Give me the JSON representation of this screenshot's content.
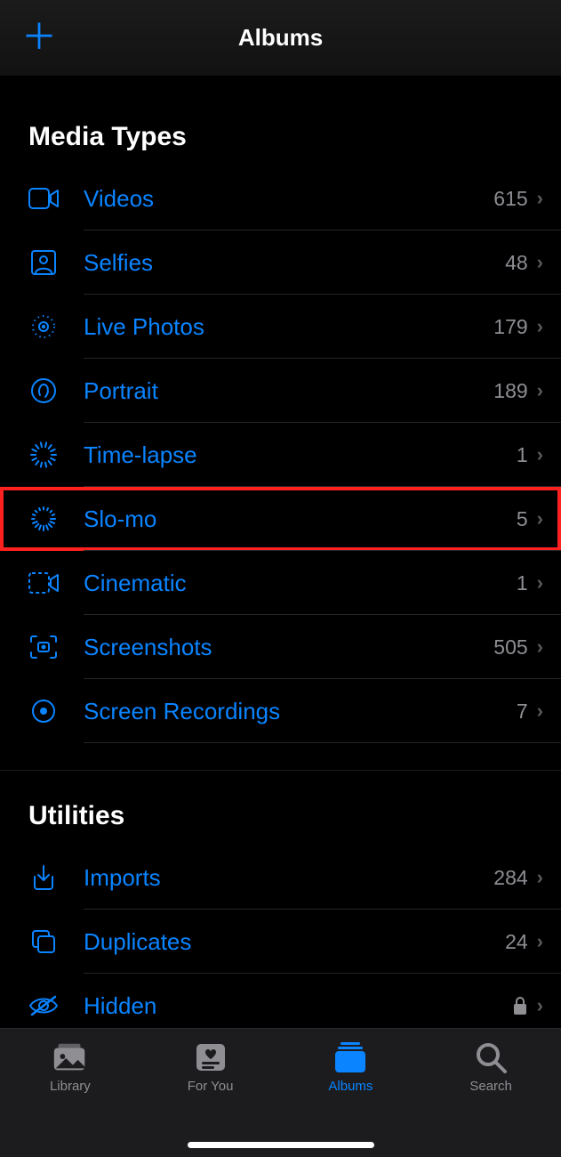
{
  "navbar": {
    "title": "Albums"
  },
  "sections": {
    "media_types": {
      "header": "Media Types",
      "items": [
        {
          "id": "videos",
          "label": "Videos",
          "count": "615"
        },
        {
          "id": "selfies",
          "label": "Selfies",
          "count": "48"
        },
        {
          "id": "live-photos",
          "label": "Live Photos",
          "count": "179"
        },
        {
          "id": "portrait",
          "label": "Portrait",
          "count": "189"
        },
        {
          "id": "time-lapse",
          "label": "Time-lapse",
          "count": "1"
        },
        {
          "id": "slo-mo",
          "label": "Slo-mo",
          "count": "5",
          "highlighted": true
        },
        {
          "id": "cinematic",
          "label": "Cinematic",
          "count": "1"
        },
        {
          "id": "screenshots",
          "label": "Screenshots",
          "count": "505"
        },
        {
          "id": "screen-recordings",
          "label": "Screen Recordings",
          "count": "7"
        }
      ]
    },
    "utilities": {
      "header": "Utilities",
      "items": [
        {
          "id": "imports",
          "label": "Imports",
          "count": "284"
        },
        {
          "id": "duplicates",
          "label": "Duplicates",
          "count": "24"
        },
        {
          "id": "hidden",
          "label": "Hidden",
          "locked": true
        }
      ]
    }
  },
  "tabs": [
    {
      "id": "library",
      "label": "Library"
    },
    {
      "id": "for-you",
      "label": "For You"
    },
    {
      "id": "albums",
      "label": "Albums",
      "active": true
    },
    {
      "id": "search",
      "label": "Search"
    }
  ]
}
